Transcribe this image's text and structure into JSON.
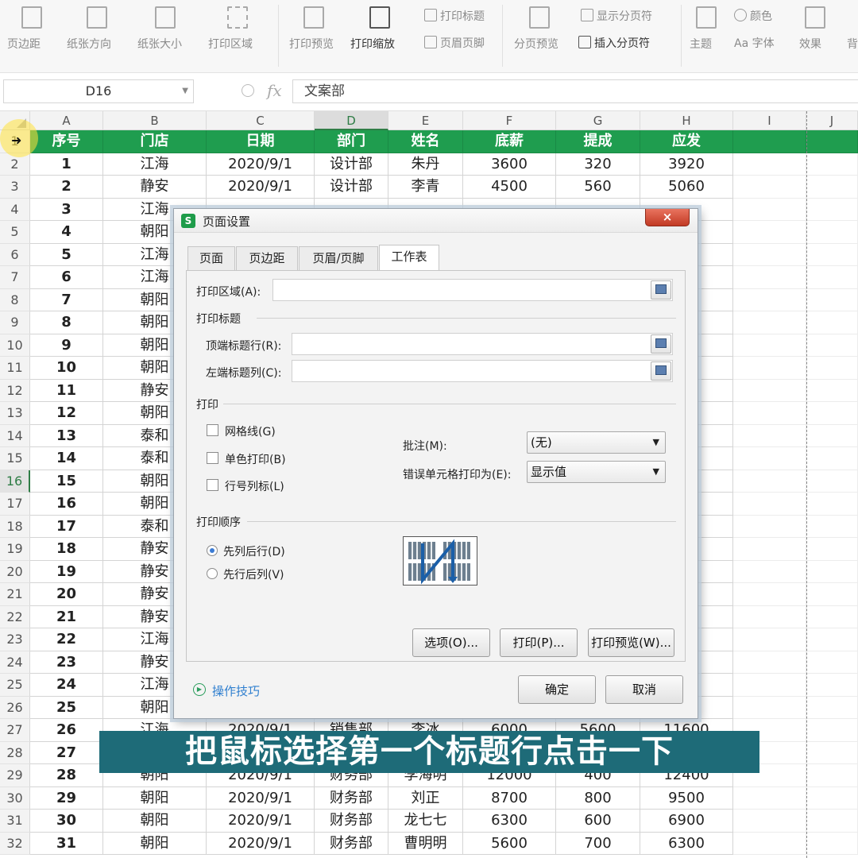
{
  "ribbon": {
    "margins": "页边距",
    "orientation": "纸张方向",
    "size": "纸张大小",
    "print_area": "打印区域",
    "print_preview": "打印预览",
    "print_scale": "打印缩放",
    "print_titles": "打印标题",
    "header_footer": "页眉页脚",
    "page_break_preview": "分页预览",
    "show_page_breaks": "显示分页符",
    "insert_page_break": "插入分页符",
    "theme": "主题",
    "colors": "颜色",
    "fonts": "字体",
    "effects": "效果",
    "background": "背"
  },
  "formula_bar": {
    "name_box": "D16",
    "fx": "fx",
    "content": "文案部"
  },
  "sheet": {
    "columns": [
      "A",
      "B",
      "C",
      "D",
      "E",
      "F",
      "G",
      "H",
      "I",
      "J"
    ],
    "active_column": "D",
    "active_row": 16,
    "header": [
      "序号",
      "门店",
      "日期",
      "部门",
      "姓名",
      "底薪",
      "提成",
      "应发"
    ],
    "rows": [
      [
        "1",
        "江海",
        "2020/9/1",
        "设计部",
        "朱丹",
        "3600",
        "320",
        "3920"
      ],
      [
        "2",
        "静安",
        "2020/9/1",
        "设计部",
        "李青",
        "4500",
        "560",
        "5060"
      ],
      [
        "3",
        "江海",
        "",
        "",
        "",
        "",
        "",
        ""
      ],
      [
        "4",
        "朝阳",
        "",
        "",
        "",
        "",
        "",
        ""
      ],
      [
        "5",
        "江海",
        "",
        "",
        "",
        "",
        "",
        ""
      ],
      [
        "6",
        "江海",
        "",
        "",
        "",
        "",
        "",
        ""
      ],
      [
        "7",
        "朝阳",
        "",
        "",
        "",
        "",
        "",
        ""
      ],
      [
        "8",
        "朝阳",
        "",
        "",
        "",
        "",
        "",
        ""
      ],
      [
        "9",
        "朝阳",
        "",
        "",
        "",
        "",
        "",
        ""
      ],
      [
        "10",
        "朝阳",
        "",
        "",
        "",
        "",
        "",
        ""
      ],
      [
        "11",
        "静安",
        "",
        "",
        "",
        "",
        "",
        ""
      ],
      [
        "12",
        "朝阳",
        "",
        "",
        "",
        "",
        "",
        ""
      ],
      [
        "13",
        "泰和",
        "",
        "",
        "",
        "",
        "",
        ""
      ],
      [
        "14",
        "泰和",
        "",
        "",
        "",
        "",
        "",
        ""
      ],
      [
        "15",
        "朝阳",
        "",
        "",
        "",
        "",
        "",
        ""
      ],
      [
        "16",
        "朝阳",
        "",
        "",
        "",
        "",
        "",
        ""
      ],
      [
        "17",
        "泰和",
        "",
        "",
        "",
        "",
        "",
        ""
      ],
      [
        "18",
        "静安",
        "",
        "",
        "",
        "",
        "",
        ""
      ],
      [
        "19",
        "静安",
        "",
        "",
        "",
        "",
        "",
        ""
      ],
      [
        "20",
        "静安",
        "",
        "",
        "",
        "",
        "",
        ""
      ],
      [
        "21",
        "静安",
        "",
        "",
        "",
        "",
        "",
        ""
      ],
      [
        "22",
        "江海",
        "",
        "",
        "",
        "",
        "",
        ""
      ],
      [
        "23",
        "静安",
        "",
        "",
        "",
        "",
        "",
        ""
      ],
      [
        "24",
        "江海",
        "",
        "",
        "",
        "",
        "",
        ""
      ],
      [
        "25",
        "朝阳",
        "",
        "",
        "",
        "",
        "",
        ""
      ],
      [
        "26",
        "江海",
        "2020/9/1",
        "销售部",
        "李冰",
        "6000",
        "5600",
        "11600"
      ],
      [
        "27",
        "",
        "",
        "",
        "",
        "",
        "",
        ""
      ],
      [
        "28",
        "朝阳",
        "2020/9/1",
        "财务部",
        "李海明",
        "12000",
        "400",
        "12400"
      ],
      [
        "29",
        "朝阳",
        "2020/9/1",
        "财务部",
        "刘正",
        "8700",
        "800",
        "9500"
      ],
      [
        "30",
        "朝阳",
        "2020/9/1",
        "财务部",
        "龙七七",
        "6300",
        "600",
        "6900"
      ],
      [
        "31",
        "朝阳",
        "2020/9/1",
        "财务部",
        "曹明明",
        "5600",
        "700",
        "6300"
      ]
    ]
  },
  "dialog": {
    "title": "页面设置",
    "logo": "S",
    "close": "×",
    "tabs": [
      "页面",
      "页边距",
      "页眉/页脚",
      "工作表"
    ],
    "active_tab": "工作表",
    "print_area_label": "打印区域(A):",
    "print_area_value": "",
    "print_titles_section": "打印标题",
    "top_rows_label": "顶端标题行(R):",
    "top_rows_value": "",
    "left_cols_label": "左端标题列(C):",
    "left_cols_value": "",
    "print_section": "打印",
    "gridlines_label": "网格线(G)",
    "gridlines_checked": false,
    "mono_label": "单色打印(B)",
    "mono_checked": false,
    "row_col_headers_label": "行号列标(L)",
    "row_col_headers_checked": false,
    "comments_label": "批注(M):",
    "comments_value": "(无)",
    "errors_label": "错误单元格打印为(E):",
    "errors_value": "显示值",
    "order_section": "打印顺序",
    "order_down_then_over": "先列后行(D)",
    "order_over_then_down": "先行后列(V)",
    "order_selected": "先列后行(D)",
    "options_button": "选项(O)...",
    "print_button": "打印(P)...",
    "preview_button": "打印预览(W)...",
    "tips_link": "操作技巧",
    "ok_button": "确定",
    "cancel_button": "取消"
  },
  "subtitle": "把鼠标选择第一个标题行点击一下",
  "colors": {
    "header_green": "#1f9d4f",
    "subtitle_bg": "#1e6b78",
    "dialog_close": "#c23a24"
  }
}
